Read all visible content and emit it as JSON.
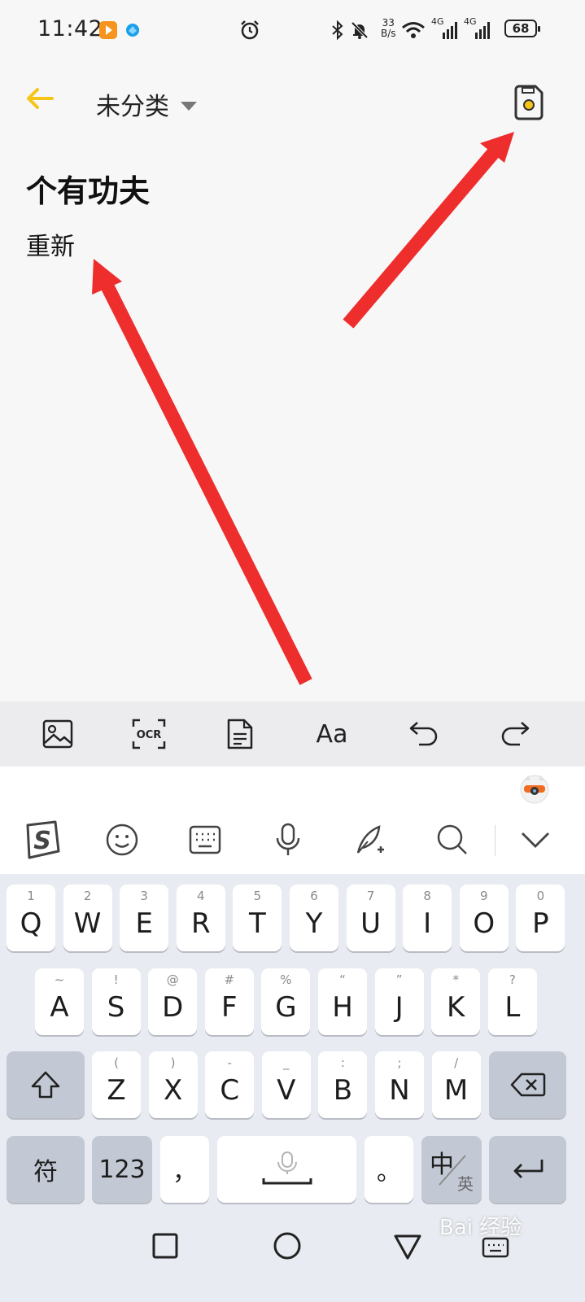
{
  "status_bar": {
    "time": "11:42",
    "net_speed_value": "33",
    "net_speed_unit": "B/s",
    "network_1": "4G",
    "network_2": "4G",
    "battery": "68"
  },
  "header": {
    "category": "未分类"
  },
  "note": {
    "title": "个有功夫",
    "body": "重新"
  },
  "toolbar": {
    "ocr_label": "OCR",
    "font_label": "Aa"
  },
  "keyboard": {
    "row1": [
      {
        "hint": "1",
        "key": "Q"
      },
      {
        "hint": "2",
        "key": "W"
      },
      {
        "hint": "3",
        "key": "E"
      },
      {
        "hint": "4",
        "key": "R"
      },
      {
        "hint": "5",
        "key": "T"
      },
      {
        "hint": "6",
        "key": "Y"
      },
      {
        "hint": "7",
        "key": "U"
      },
      {
        "hint": "8",
        "key": "I"
      },
      {
        "hint": "9",
        "key": "O"
      },
      {
        "hint": "0",
        "key": "P"
      }
    ],
    "row2": [
      {
        "hint": "~",
        "key": "A"
      },
      {
        "hint": "!",
        "key": "S"
      },
      {
        "hint": "@",
        "key": "D"
      },
      {
        "hint": "#",
        "key": "F"
      },
      {
        "hint": "%",
        "key": "G"
      },
      {
        "hint": "“",
        "key": "H"
      },
      {
        "hint": "”",
        "key": "J"
      },
      {
        "hint": "*",
        "key": "K"
      },
      {
        "hint": "?",
        "key": "L"
      }
    ],
    "row3": [
      {
        "hint": "(",
        "key": "Z"
      },
      {
        "hint": ")",
        "key": "X"
      },
      {
        "hint": "-",
        "key": "C"
      },
      {
        "hint": "_",
        "key": "V"
      },
      {
        "hint": ":",
        "key": "B"
      },
      {
        "hint": ";",
        "key": "N"
      },
      {
        "hint": "/",
        "key": "M"
      }
    ],
    "symbols_label": "符",
    "numbers_label": "123",
    "comma_label": "，",
    "period_label": "。",
    "lang_primary": "中",
    "lang_secondary": "英"
  },
  "watermark": "Bai 经验",
  "colors": {
    "accent": "#f5c518",
    "arrow": "#ee2d2d",
    "keyboard_bg": "#e8ebf1",
    "toolbar_bg": "#ececee"
  }
}
